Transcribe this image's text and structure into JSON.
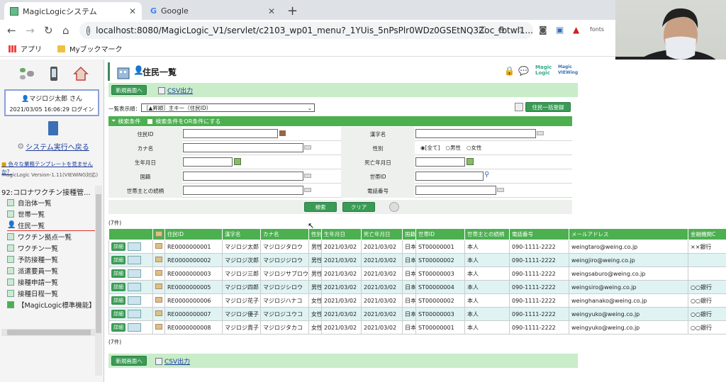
{
  "browser": {
    "tabs": [
      {
        "title": "MagicLogicシステム",
        "active": true
      },
      {
        "title": "Google",
        "active": false
      }
    ],
    "new_tab": "+",
    "url": "localhost:8080/MagicLogic_V1/servlet/c2103_wp01_menu?_1YUis_5nPsPlr0WDz0GSEtNQ3Zoc_fbtwl1...",
    "bookmarks": [
      {
        "label": "アプリ",
        "icon": "apps-grid-icon"
      },
      {
        "label": "Myブックマーク",
        "icon": "folder-icon"
      }
    ],
    "extension_label": "fonts"
  },
  "sidebar": {
    "user_name": "マジロジ太郎 さん",
    "login_time": "2021/03/05 16:06:29 ログイン",
    "system_back": "システム実行へ戻る",
    "template_link": "色々な業務テンプレートを見ませんか？",
    "version": "MagicLogic Version-1.11(VIEWiNG対応)",
    "nav_header": "92:コロナワクチン接種管...",
    "items": [
      {
        "label": "自治体一覧",
        "selected": false
      },
      {
        "label": "世帯一覧",
        "selected": false
      },
      {
        "label": "住民一覧",
        "selected": true
      },
      {
        "label": "ワクチン拠点一覧",
        "selected": false
      },
      {
        "label": "ワクチン一覧",
        "selected": false
      },
      {
        "label": "予防接種一覧",
        "selected": false
      },
      {
        "label": "派遣要員一覧",
        "selected": false
      },
      {
        "label": "接種申請一覧",
        "selected": false
      },
      {
        "label": "接種日程一覧",
        "selected": false
      },
      {
        "label": "【MagicLogic標準機能】",
        "selected": false
      }
    ]
  },
  "main": {
    "title": "住民一覧",
    "logo_text": "Magic Logic",
    "viewing_text": "Magic VIEWing",
    "new_button": "新規画面へ",
    "csv_link": "CSV出力",
    "sort_label": "一覧表示順：",
    "sort_value": "［▲昇順］主キー（住民ID）",
    "bulk_register": "住民一括登録",
    "search_header": "検索条件",
    "or_condition": "検索条件をOR条件にする",
    "fields": {
      "resident_id": "住民ID",
      "kanji_name": "漢字名",
      "kana_name": "カナ名",
      "gender": "性別",
      "birth_date": "生年月日",
      "death_date": "死亡年月日",
      "nationality": "国籍",
      "household_id": "世帯ID",
      "relation": "世帯主との続柄",
      "phone": "電話番号"
    },
    "gender_options": [
      "[全て]",
      "男性",
      "女性"
    ],
    "search_button": "検索",
    "clear_button": "クリア",
    "count": "(7件)",
    "columns": [
      "",
      "",
      "住民ID",
      "漢字名",
      "カナ名",
      "性別",
      "生年月日",
      "死亡年月日",
      "国籍",
      "世帯ID",
      "世帯主との続柄",
      "電話番号",
      "メールアドレス",
      "金融機関C"
    ],
    "detail_label": "詳細",
    "rows": [
      {
        "id": "RE0000000001",
        "kanji": "マジロジ太郎",
        "kana": "マジロジタロウ",
        "gender": "男性",
        "birth": "2021/03/02",
        "death": "2021/03/02",
        "nation": "日本",
        "household": "ST00000001",
        "relation": "本人",
        "phone": "090-1111-2222",
        "email": "weingtaro@weing.co.jp",
        "bank": "××銀行"
      },
      {
        "id": "RE0000000002",
        "kanji": "マジロジ次郎",
        "kana": "マジロジジロウ",
        "gender": "男性",
        "birth": "2021/03/02",
        "death": "2021/03/02",
        "nation": "日本",
        "household": "ST00000002",
        "relation": "本人",
        "phone": "090-1111-2222",
        "email": "weingjiro@weing.co.jp",
        "bank": ""
      },
      {
        "id": "RE0000000003",
        "kanji": "マジロジ三郎",
        "kana": "マジロジサブロウ",
        "gender": "男性",
        "birth": "2021/03/02",
        "death": "2021/03/02",
        "nation": "日本",
        "household": "ST00000003",
        "relation": "本人",
        "phone": "090-1111-2222",
        "email": "weingsaburo@weing.co.jp",
        "bank": ""
      },
      {
        "id": "RE0000000005",
        "kanji": "マジロジ四郎",
        "kana": "マジロジシロウ",
        "gender": "男性",
        "birth": "2021/03/02",
        "death": "2021/03/02",
        "nation": "日本",
        "household": "ST00000004",
        "relation": "本人",
        "phone": "090-1111-2222",
        "email": "weingsiro@weing.co.jp",
        "bank": "○○銀行"
      },
      {
        "id": "RE0000000006",
        "kanji": "マジロジ花子",
        "kana": "マジロジハナコ",
        "gender": "女性",
        "birth": "2021/03/02",
        "death": "2021/03/02",
        "nation": "日本",
        "household": "ST00000002",
        "relation": "本人",
        "phone": "090-1111-2222",
        "email": "weinghanako@weing.co.jp",
        "bank": "○○銀行"
      },
      {
        "id": "RE0000000007",
        "kanji": "マジロジ優子",
        "kana": "マジロジユウコ",
        "gender": "女性",
        "birth": "2021/03/02",
        "death": "2021/03/02",
        "nation": "日本",
        "household": "ST00000003",
        "relation": "本人",
        "phone": "090-1111-2222",
        "email": "weingyuko@weing.co.jp",
        "bank": "○○銀行"
      },
      {
        "id": "RE0000000008",
        "kanji": "マジロジ貴子",
        "kana": "マジロジタカコ",
        "gender": "女性",
        "birth": "2021/03/02",
        "death": "2021/03/02",
        "nation": "日本",
        "household": "ST00000001",
        "relation": "本人",
        "phone": "090-1111-2222",
        "email": "weingyuko@weing.co.jp",
        "bank": "○○銀行"
      }
    ]
  },
  "colors": {
    "accent_green": "#4caf50",
    "button_green": "#3a9b55",
    "bar_green": "#c9ecc9",
    "row_alt": "#dff3f3",
    "link_blue": "#1a3a9a"
  }
}
